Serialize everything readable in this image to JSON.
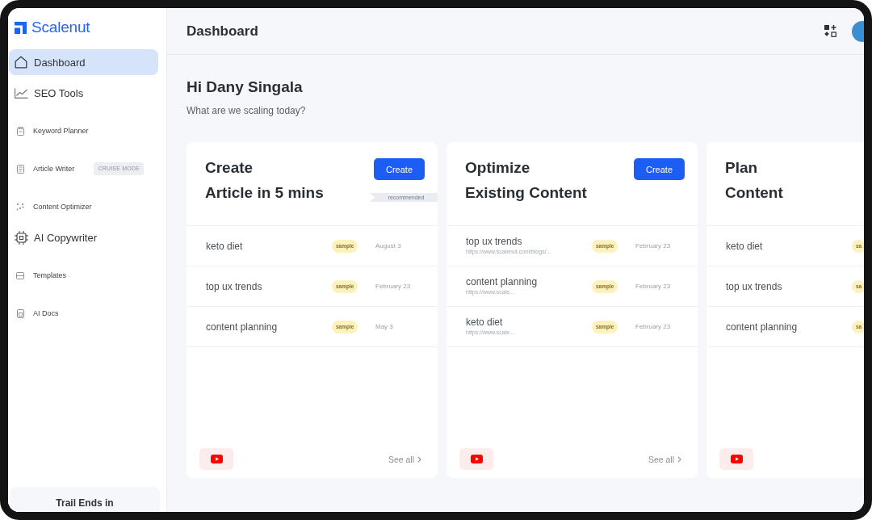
{
  "sidebar": {
    "logo": "Scalenut",
    "items": [
      {
        "label": "Dashboard",
        "selected": true
      },
      {
        "label": "SEO Tools",
        "selected": false,
        "children": [
          {
            "label": "Keyword Planner",
            "selected": false
          },
          {
            "label": "Article Writer",
            "selected": false,
            "badge": "CRUISE MODE"
          },
          {
            "label": "Content Optimizer",
            "selected": false
          }
        ]
      },
      {
        "label": "AI Copywriter",
        "selected": false,
        "children": [
          {
            "label": "Templates",
            "selected": false
          },
          {
            "label": "AI Docs",
            "selected": false
          }
        ]
      }
    ],
    "trial_banner": "Trail Ends in"
  },
  "header": {
    "title": "Dashboard"
  },
  "greeting": {
    "title": "Hi Dany Singala",
    "subtitle": "What are we scaling today?"
  },
  "cards": [
    {
      "title_lines": [
        "Create",
        "Article in 5 mins"
      ],
      "button": "Create",
      "ribbon": "recommended",
      "rows": [
        {
          "title": "keto diet",
          "badge": "sample",
          "date": "August 3"
        },
        {
          "title": "top ux trends",
          "badge": "sample",
          "date": "February 23"
        },
        {
          "title": "content planning",
          "badge": "sample",
          "date": "May 3"
        }
      ],
      "see_all": "See all"
    },
    {
      "title_lines": [
        "Optimize",
        "Existing Content"
      ],
      "button": "Create",
      "rows": [
        {
          "title": "top ux trends",
          "url": "https://www.scalenut.com/blogs/...",
          "badge": "sample",
          "date": "February 23"
        },
        {
          "title": "content planning",
          "url": "https://www.scale...",
          "badge": "sample",
          "date": "February 23"
        },
        {
          "title": "keto diet",
          "url": "https://www.scale...",
          "badge": "sample",
          "date": "February 23"
        }
      ],
      "see_all": "See all"
    },
    {
      "title_lines": [
        "Plan",
        "Content"
      ],
      "rows": [
        {
          "title": "keto diet",
          "badge": "sa"
        },
        {
          "title": "top ux trends",
          "badge": "sa"
        },
        {
          "title": "content planning",
          "badge": "sa"
        }
      ]
    }
  ]
}
